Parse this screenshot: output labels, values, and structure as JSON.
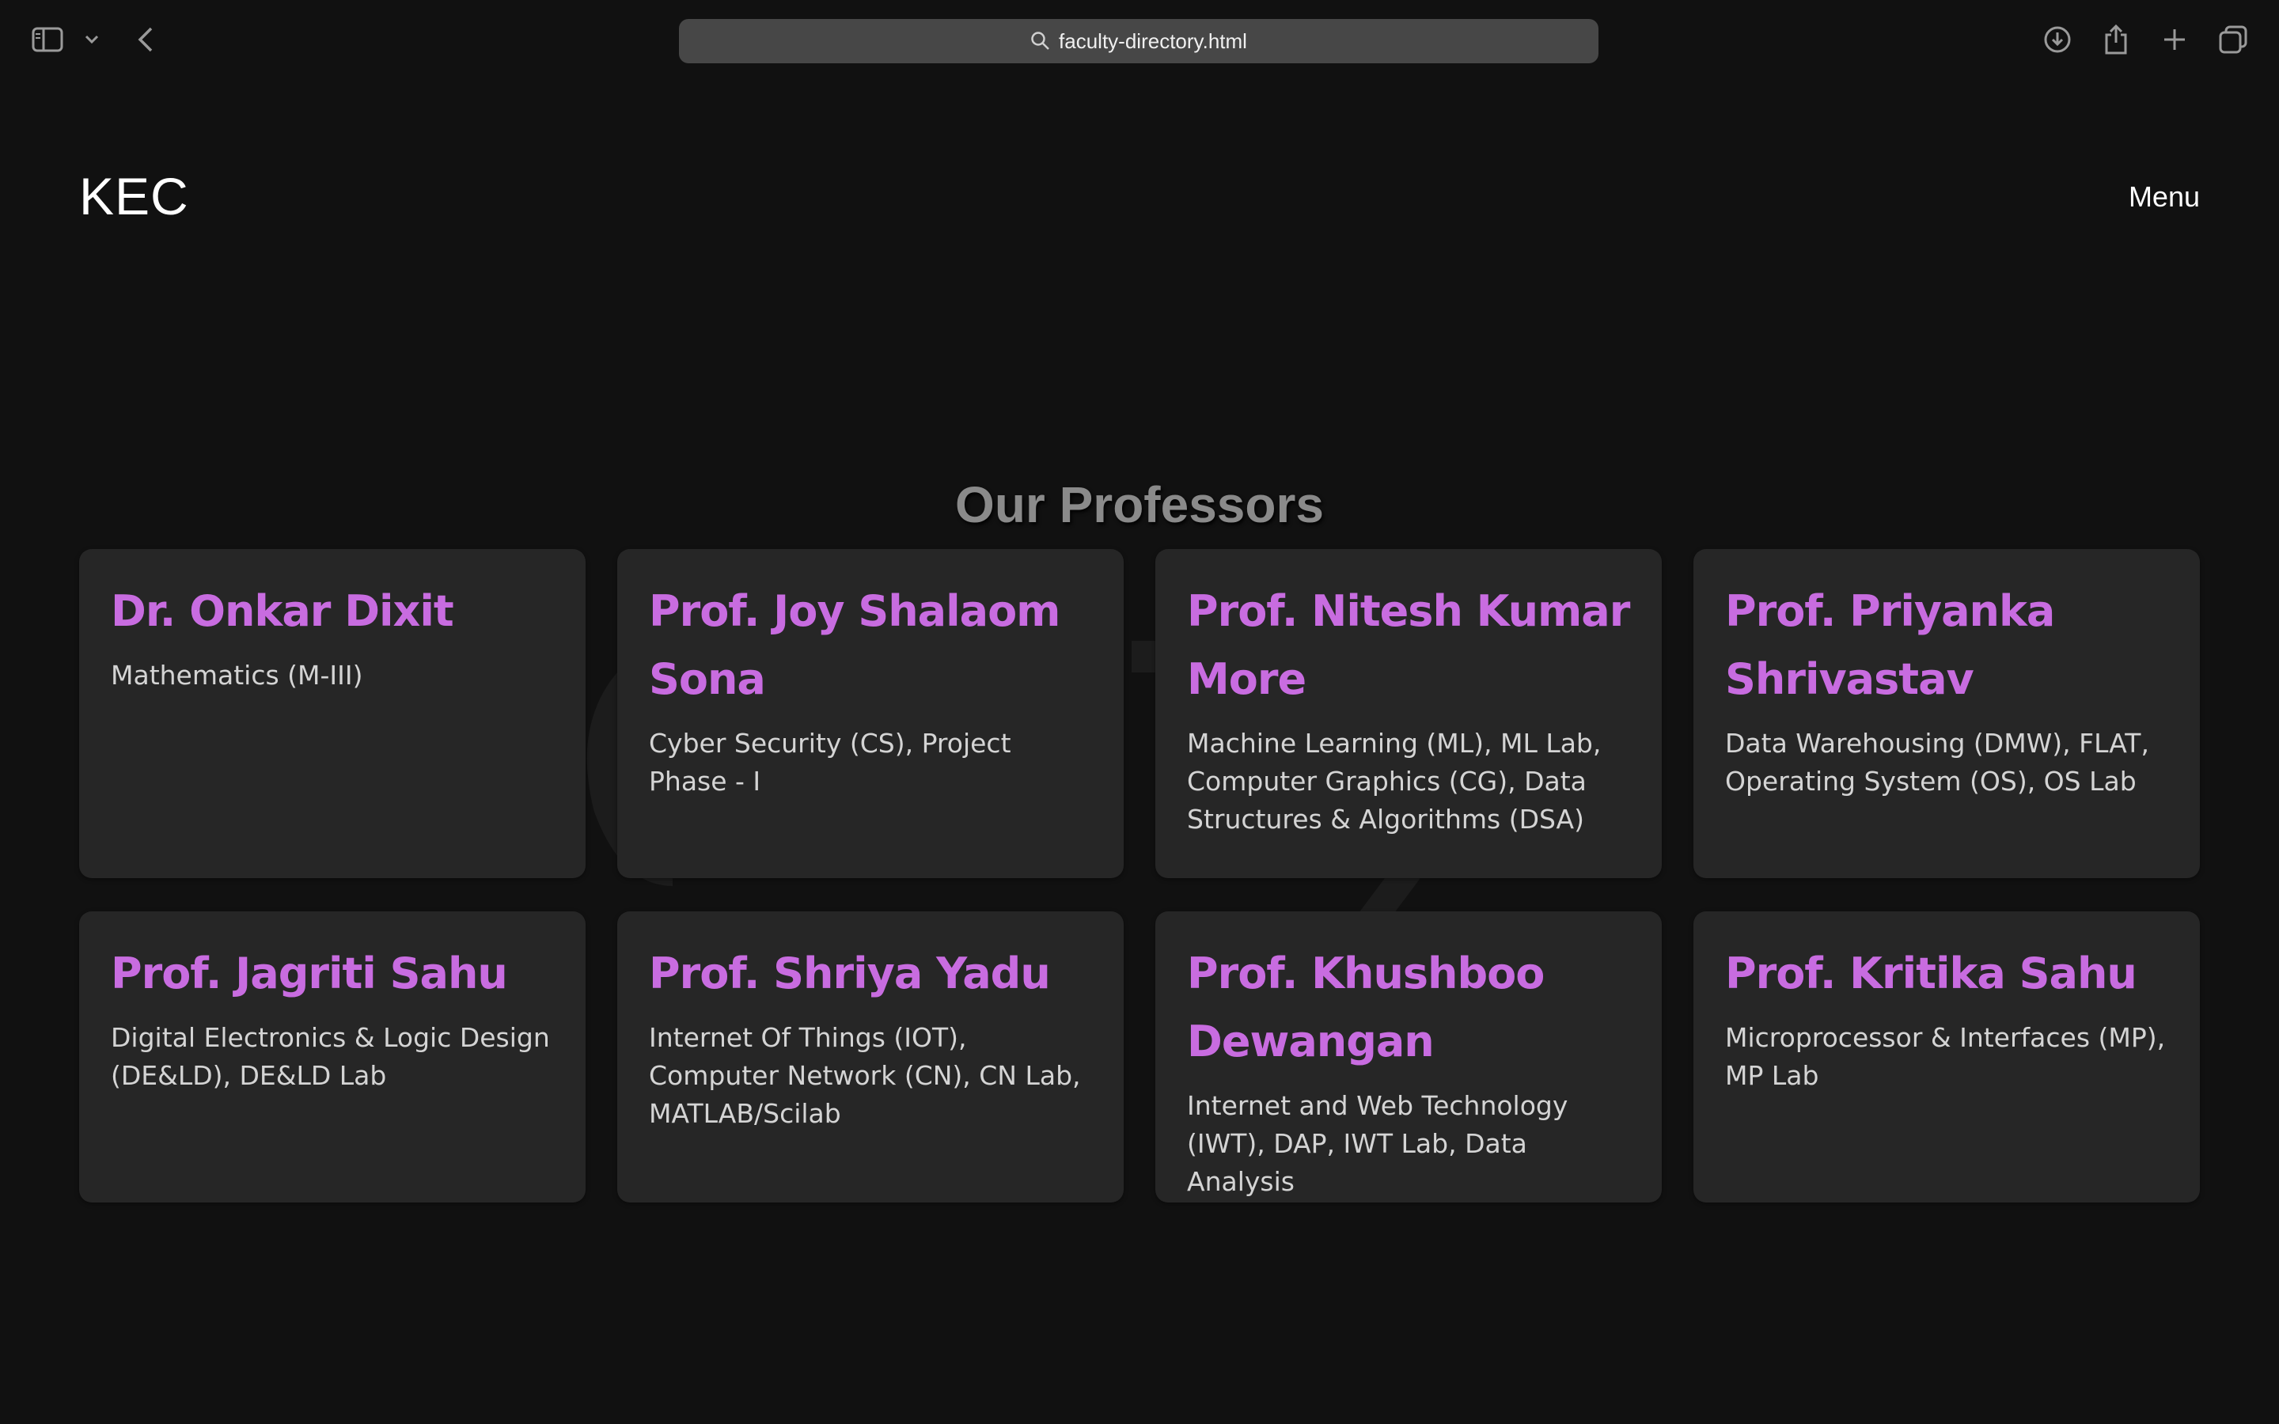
{
  "browser": {
    "url": "faculty-directory.html",
    "icons": [
      "sidebar-icon",
      "chevron-down-icon",
      "back-icon",
      "search-icon",
      "download-icon",
      "share-icon",
      "plus-icon",
      "tabs-icon"
    ]
  },
  "header": {
    "logo": "KEC",
    "menu_label": "Menu"
  },
  "page": {
    "title": "Our Professors"
  },
  "colors": {
    "background": "#111111",
    "card": "#262626",
    "accent": "#c86ce0",
    "title": "#8a8a8a"
  },
  "professors": [
    {
      "name": "Dr. Onkar Dixit",
      "subjects": "Mathematics (M-III)"
    },
    {
      "name": "Prof. Joy Shalaom Sona",
      "subjects": "Cyber Security (CS), Project Phase - I"
    },
    {
      "name": "Prof. Nitesh Kumar More",
      "subjects": "Machine Learning (ML), ML Lab, Computer Graphics (CG), Data Structures & Algorithms (DSA)"
    },
    {
      "name": "Prof. Priyanka Shrivastav",
      "subjects": "Data Warehousing (DMW), FLAT, Operating System (OS), OS Lab"
    },
    {
      "name": "Prof. Jagriti Sahu",
      "subjects": "Digital Electronics & Logic Design (DE&LD), DE&LD Lab"
    },
    {
      "name": "Prof. Shriya Yadu",
      "subjects": "Internet Of Things (IOT), Computer Network (CN), CN Lab, MATLAB/Scilab"
    },
    {
      "name": "Prof. Khushboo Dewangan",
      "subjects": "Internet and Web Technology (IWT), DAP, IWT Lab, Data Analysis"
    },
    {
      "name": "Prof. Kritika Sahu",
      "subjects": "Microprocessor & Interfaces (MP), MP Lab"
    }
  ]
}
